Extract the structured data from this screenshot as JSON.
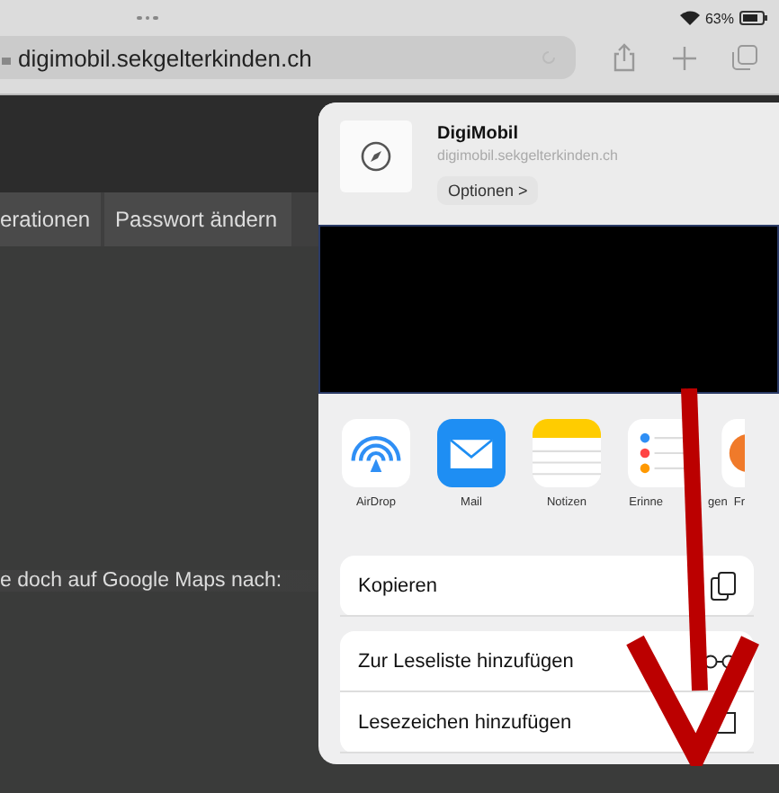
{
  "status_bar": {
    "battery": "63%"
  },
  "address_bar": {
    "url": "digimobil.sekgelterkinden.ch"
  },
  "page": {
    "tabs": [
      {
        "label": "erationen"
      },
      {
        "label": "Passwort ändern"
      }
    ],
    "text": "e doch auf Google Maps nach:"
  },
  "share_sheet": {
    "title": "DigiMobil",
    "subtitle": "digimobil.sekgelterkinden.ch",
    "options_button": "Optionen >",
    "apps": [
      {
        "kind": "airdrop",
        "label": "AirDrop"
      },
      {
        "kind": "mail",
        "label": "Mail"
      },
      {
        "kind": "notes",
        "label": "Notizen"
      },
      {
        "kind": "reminders",
        "label_parts": [
          "Erinne",
          "gen"
        ]
      },
      {
        "kind": "other",
        "label": "Fr"
      }
    ],
    "action_groups": [
      [
        {
          "kind": "copy",
          "label": "Kopieren"
        }
      ],
      [
        {
          "kind": "reading-list",
          "label": "Zur Leseliste hinzufügen"
        },
        {
          "kind": "bookmark",
          "label": "Lesezeichen hinzufügen"
        }
      ]
    ]
  }
}
